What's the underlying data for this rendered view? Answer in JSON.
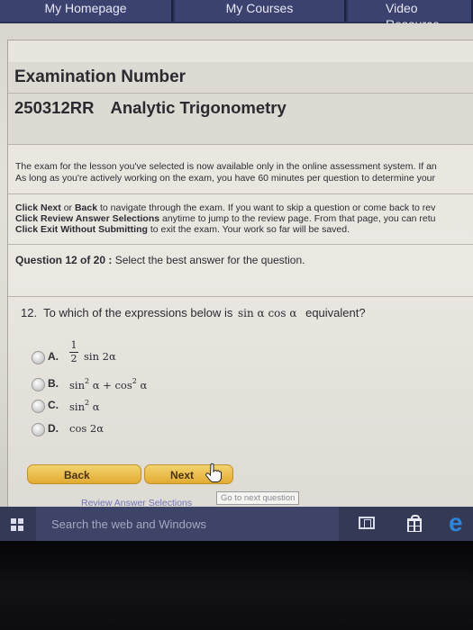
{
  "nav": {
    "home": "My Homepage",
    "courses": "My Courses",
    "video": "Video Resource"
  },
  "exam": {
    "heading": "Examination Number",
    "number": "250312RR",
    "course": "Analytic Trigonometry"
  },
  "instructions": {
    "line1": "The exam for the lesson you've selected is now available only in the online assessment system. If an",
    "line2": "As long as you're actively working on the exam, you have 60 minutes per question to determine your",
    "l3_bold1": "Click Next",
    "l3_or": " or ",
    "l3_bold2": "Back",
    "l3_rest": " to navigate through the exam. If you want to skip a question or come back to rev",
    "l4_bold": "Click Review Answer Selections",
    "l4_rest": " anytime to jump to the review page. From that page, you can retu",
    "l5_bold": "Click Exit Without Submitting",
    "l5_rest": " to exit the exam. Your work so far will be saved."
  },
  "question": {
    "header_bold": "Question 12 of 20 :",
    "header_rest": " Select the best answer for the question.",
    "number": "12.",
    "prompt_start": "To which of the expressions below is",
    "expression": "sin α cos α",
    "prompt_end": "equivalent?",
    "options": [
      {
        "letter": "A.",
        "num": "1",
        "den": "2",
        "text": "sin 2α"
      },
      {
        "letter": "B.",
        "text": "sin",
        "sup1": "2",
        "mid": " α + cos",
        "sup2": "2",
        "end": " α"
      },
      {
        "letter": "C.",
        "text": "sin",
        "sup1": "2",
        "end": " α"
      },
      {
        "letter": "D.",
        "text": "cos 2α"
      }
    ]
  },
  "buttons": {
    "back": "Back",
    "next": "Next",
    "review": "Review Answer Selections",
    "tooltip": "Go to next question"
  },
  "taskbar": {
    "search_placeholder": "Search the web and Windows"
  },
  "colors": {
    "nav_bg": "#3b4270",
    "button": "#e9b640",
    "taskbar": "#343a56",
    "edge": "#2b86d9"
  },
  "icons": [
    "windows-start-icon",
    "task-view-icon",
    "store-icon",
    "edge-icon",
    "hand-cursor-icon"
  ]
}
